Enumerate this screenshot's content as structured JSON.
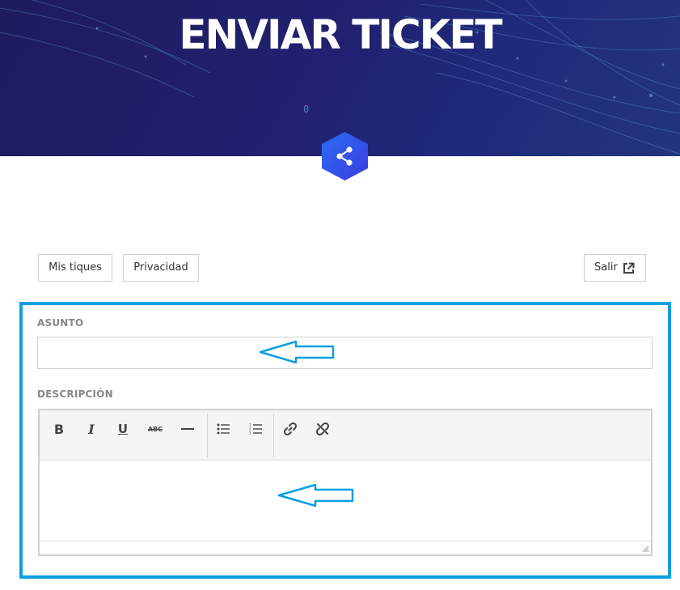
{
  "hero": {
    "title": "ENVIAR TICKET",
    "digit": "0"
  },
  "share": {
    "icon": "share-icon",
    "color": "#2f5cf0"
  },
  "nav": {
    "my_tickets": "Mis tiques",
    "privacy": "Privacidad",
    "exit": "Salir",
    "exit_icon": "external-link-icon"
  },
  "form": {
    "frame_color": "#0a9fe0",
    "subject": {
      "label": "ASUNTO",
      "value": ""
    },
    "description": {
      "label": "DESCRIPCIÓN",
      "value": ""
    },
    "toolbar": {
      "bold": "B",
      "italic": "I",
      "underline": "U",
      "strikethrough": "ABC",
      "icons": [
        "bold-icon",
        "italic-icon",
        "underline-icon",
        "strikethrough-icon",
        "horizontal-rule-icon",
        "bulleted-list-icon",
        "numbered-list-icon",
        "link-icon",
        "unlink-icon"
      ]
    }
  }
}
